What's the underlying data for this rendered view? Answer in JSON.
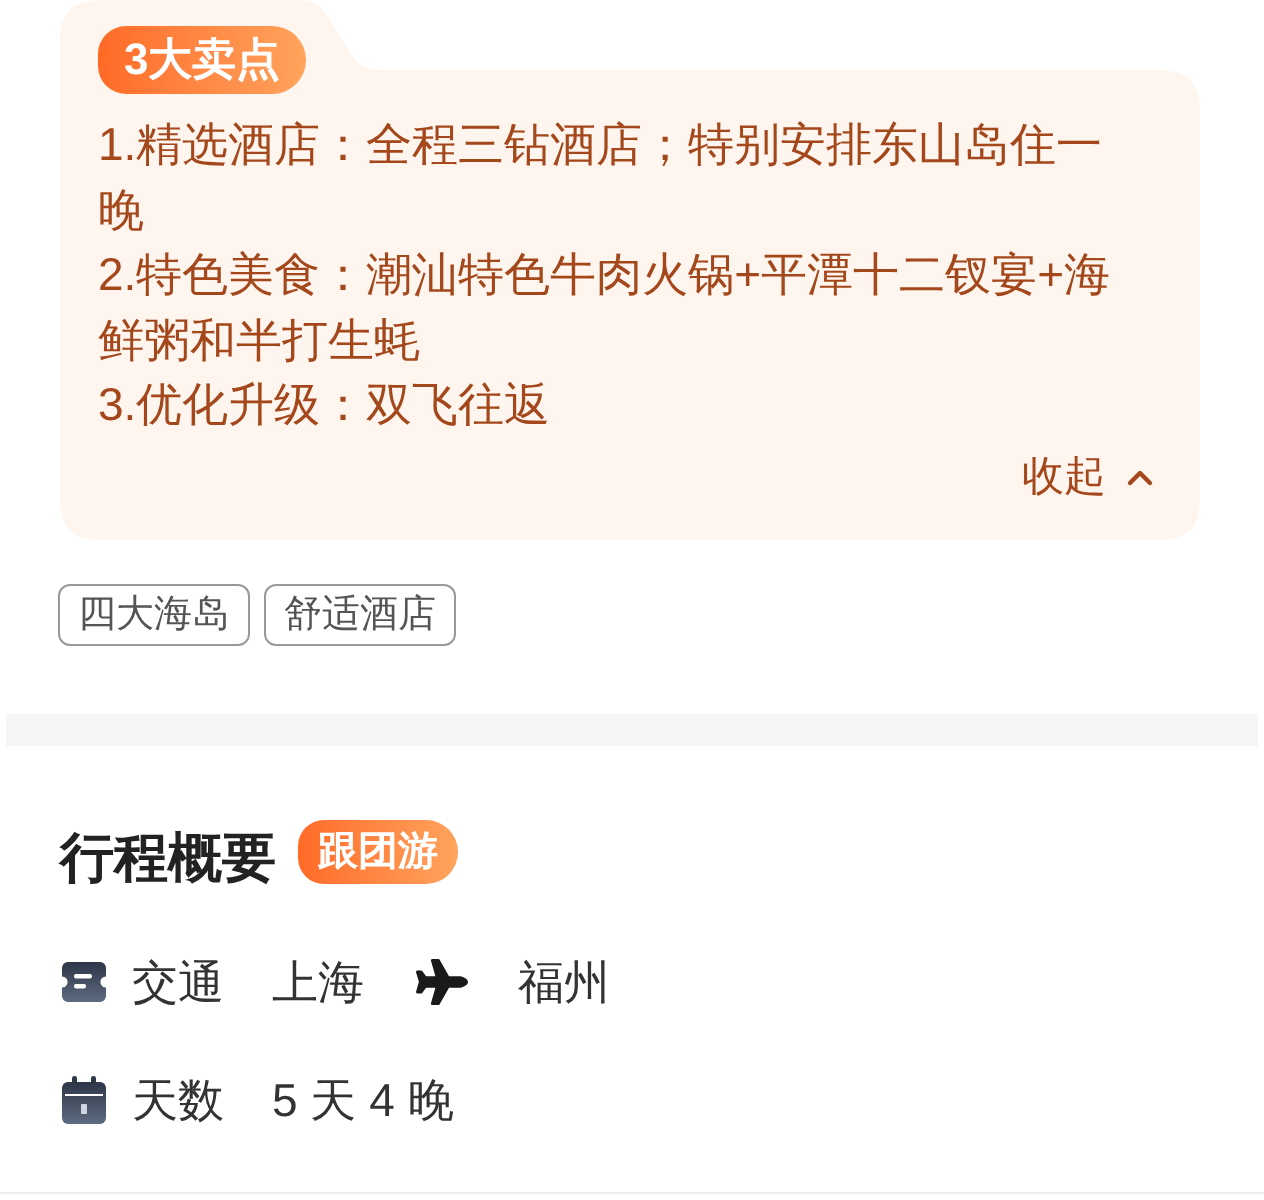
{
  "highlights": {
    "badge": "3大卖点",
    "items": [
      "1.精选酒店：全程三钻酒店；特别安排东山岛住一晚",
      "2.特色美食：潮汕特色牛肉火锅+平潭十二钗宴+海鲜粥和半打生蚝",
      "3.优化升级：双飞往返"
    ],
    "collapse_label": "收起",
    "expanded": true
  },
  "tags": [
    "四大海岛",
    "舒适酒店"
  ],
  "overview": {
    "title": "行程概要",
    "badge": "跟团游",
    "rows": [
      {
        "kind": "route",
        "label": "交通",
        "from": "上海",
        "to": "福州"
      },
      {
        "kind": "duration",
        "label": "天数",
        "value": "5 天 4 晚"
      }
    ]
  }
}
